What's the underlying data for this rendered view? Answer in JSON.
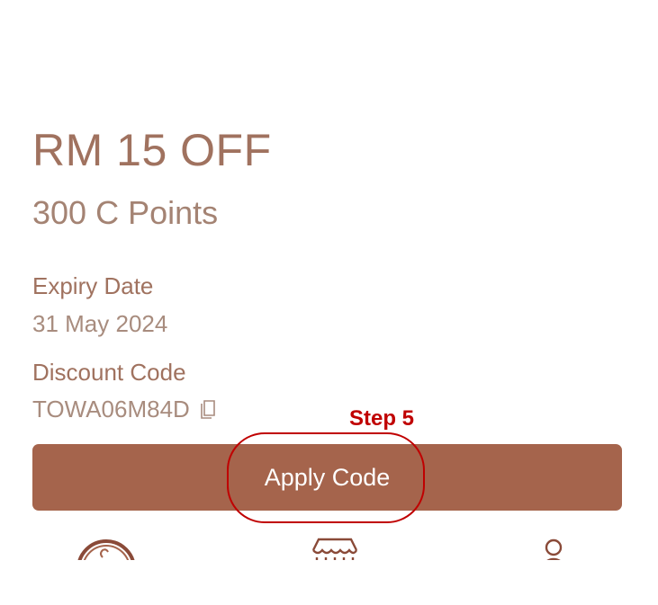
{
  "voucher": {
    "title": "RM 15 OFF",
    "points": "300 C Points"
  },
  "expiry": {
    "label": "Expiry Date",
    "value": "31 May 2024"
  },
  "discount": {
    "label": "Discount Code",
    "value": "TOWA06M84D",
    "copy_icon": "copy-icon"
  },
  "annotation": {
    "step_label": "Step 5",
    "color": "#c00000"
  },
  "apply_button": {
    "label": "Apply Code",
    "color": "#a5644c"
  },
  "bottom_nav": {
    "items": [
      {
        "icon": "home-logo-icon"
      },
      {
        "icon": "store-icon"
      },
      {
        "icon": "profile-icon"
      }
    ]
  },
  "colors": {
    "primary_text": "#a0725f",
    "secondary_text": "#a88c7e"
  }
}
